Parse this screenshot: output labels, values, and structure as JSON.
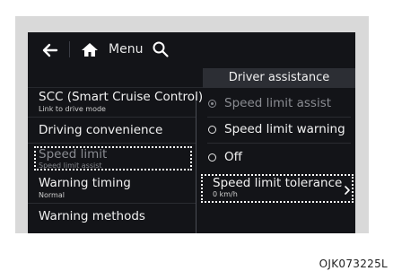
{
  "topbar": {
    "back_icon": "arrow-left-icon",
    "home_icon": "home-icon",
    "menu_label": "Menu",
    "search_icon": "search-icon"
  },
  "header": {
    "title": "Driver assistance"
  },
  "left_menu": {
    "items": [
      {
        "title": "SCC (Smart Cruise Control)",
        "sub": "Link to drive mode"
      },
      {
        "title": "Driving convenience",
        "sub": ""
      },
      {
        "title": "Speed limit",
        "sub": "Speed limit assist"
      },
      {
        "title": "Warning timing",
        "sub": "Normal"
      },
      {
        "title": "Warning methods",
        "sub": ""
      }
    ]
  },
  "right_panel": {
    "options": [
      {
        "label": "Speed limit assist",
        "selected": true
      },
      {
        "label": "Speed limit warning",
        "selected": false
      },
      {
        "label": "Off",
        "selected": false
      }
    ],
    "tolerance": {
      "title": "Speed limit tolerance",
      "value": "0 km/h",
      "chevron_icon": "chevron-right-icon"
    }
  },
  "caption": "OJK073225L",
  "colors": {
    "screen_bg": "#131418",
    "header_bg": "#2c2e34",
    "frame_bg": "#d9d9d9",
    "text": "#f2f2f2",
    "dim_text": "#8a8c92"
  }
}
